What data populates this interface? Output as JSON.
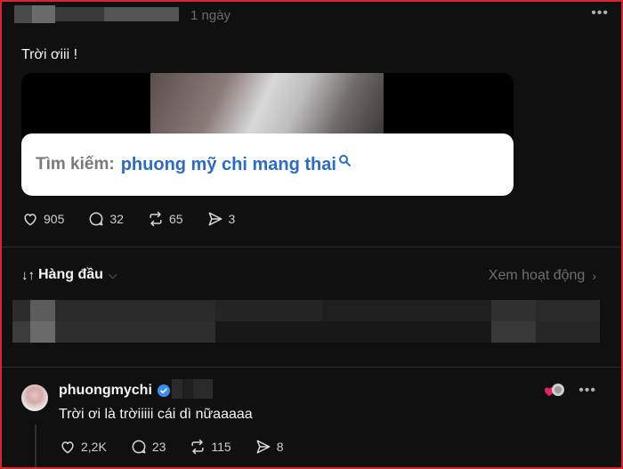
{
  "post": {
    "time": "1 ngày",
    "more_label": "•••",
    "text": "Trời ơiii !",
    "search": {
      "label": "Tìm kiếm:",
      "query": "phuong mỹ chi mang thai"
    },
    "likes": "905",
    "comments": "32",
    "reposts": "65",
    "shares": "3"
  },
  "sort_bar": {
    "sort_label": "Hàng đầu",
    "activity_label": "Xem hoạt động"
  },
  "reply": {
    "username": "phuongmychi",
    "text": "Trời ơi là trờiiiii cái dì nữaaaaa",
    "more_label": "•••",
    "likes": "2,2K",
    "comments": "23",
    "reposts": "115",
    "shares": "8"
  },
  "colors": {
    "background": "#101010",
    "frame_border": "#d6252b",
    "search_query": "#2a6cc4",
    "verified": "#3b8ef0",
    "muted_text": "#6f6f6f"
  }
}
